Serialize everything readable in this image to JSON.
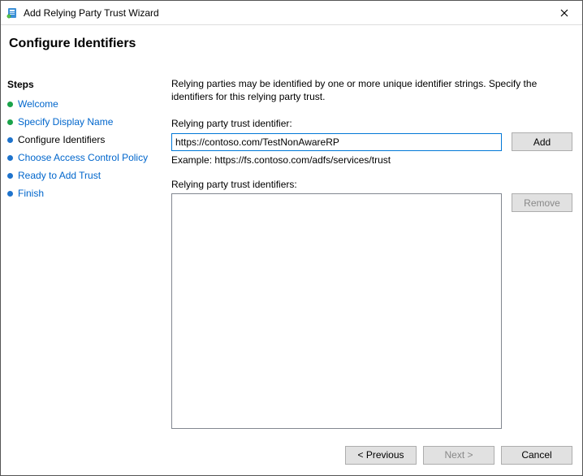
{
  "window": {
    "title": "Add Relying Party Trust Wizard"
  },
  "heading": "Configure Identifiers",
  "sidebar": {
    "heading": "Steps",
    "items": [
      {
        "label": "Welcome",
        "state": "completed"
      },
      {
        "label": "Specify Display Name",
        "state": "completed"
      },
      {
        "label": "Configure Identifiers",
        "state": "current"
      },
      {
        "label": "Choose Access Control Policy",
        "state": "pending"
      },
      {
        "label": "Ready to Add Trust",
        "state": "pending"
      },
      {
        "label": "Finish",
        "state": "pending"
      }
    ]
  },
  "content": {
    "intro": "Relying parties may be identified by one or more unique identifier strings. Specify the identifiers for this relying party trust.",
    "identifier_label": "Relying party trust identifier:",
    "identifier_value": "https://contoso.com/TestNonAwareRP",
    "add_button": "Add",
    "example": "Example: https://fs.contoso.com/adfs/services/trust",
    "list_label": "Relying party trust identifiers:",
    "remove_button": "Remove",
    "identifiers_list": []
  },
  "footer": {
    "previous": "< Previous",
    "next": "Next >",
    "cancel": "Cancel"
  }
}
